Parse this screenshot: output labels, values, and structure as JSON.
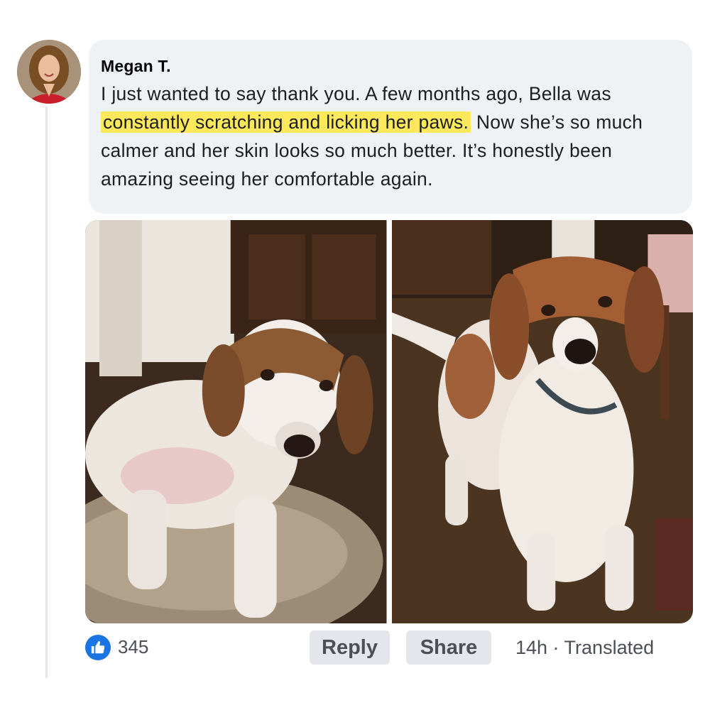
{
  "comment": {
    "author": "Megan T.",
    "text_before_highlight": "I just wanted to say thank you. A few months ago, Bella was ",
    "highlight": "constantly scratching and licking her paws.",
    "text_after_highlight": " Now she’s so much calmer and her skin looks so much better. It’s honestly been amazing seeing her comfortable again.",
    "highlight_color": "#fde95b"
  },
  "footer": {
    "like_count": "345",
    "reply_label": "Reply",
    "share_label": "Share",
    "meta": "14h · Translated",
    "like_icon": "thumbs-up-icon",
    "accent_color": "#1b74e4"
  }
}
